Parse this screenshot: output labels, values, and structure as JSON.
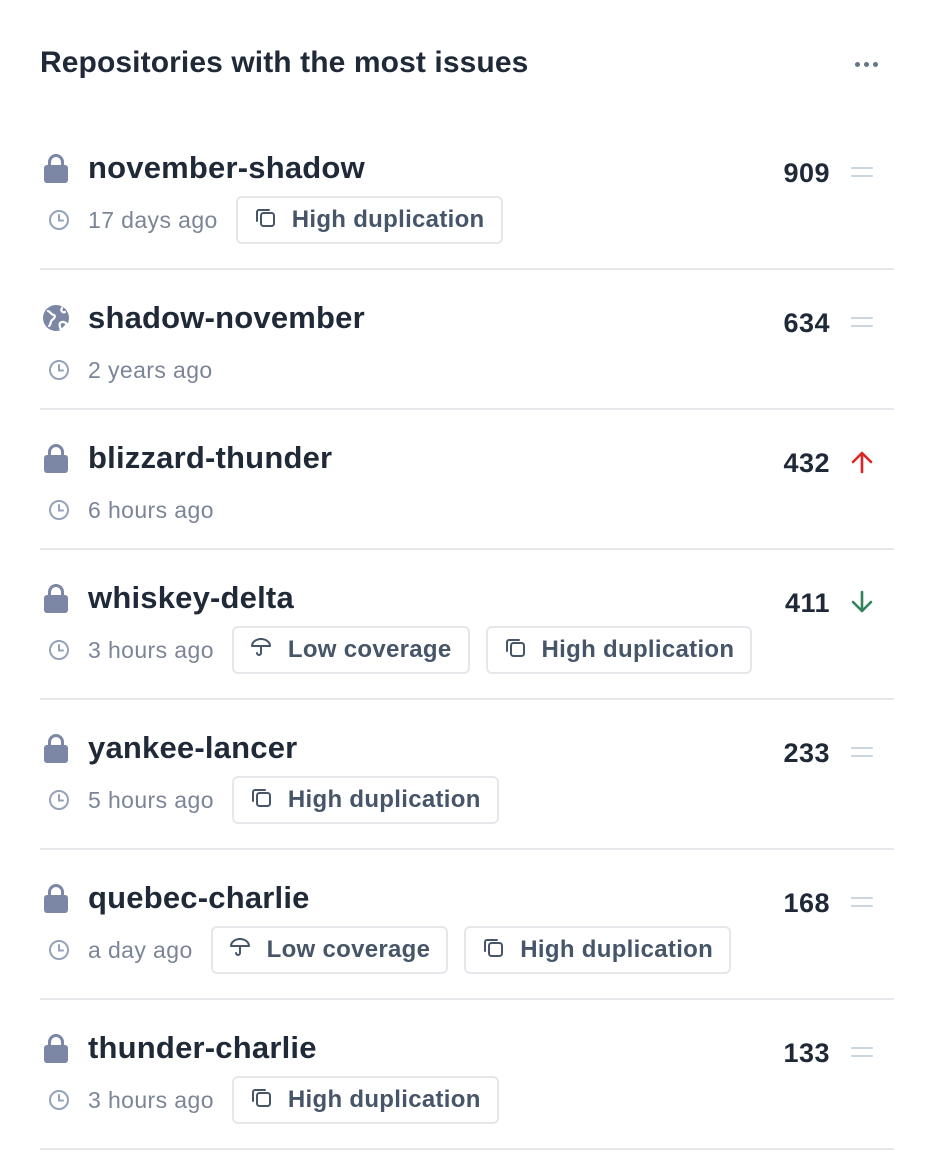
{
  "header": {
    "title": "Repositories with the most issues"
  },
  "rows": [
    {
      "name": "november-shadow",
      "visibility": "lock-icon",
      "time": "17 days ago",
      "badges": [
        "High duplication"
      ],
      "count": "909",
      "trend": "equals-icon"
    },
    {
      "name": "shadow-november",
      "visibility": "globe-icon",
      "time": "2 years ago",
      "badges": [],
      "count": "634",
      "trend": "equals-icon"
    },
    {
      "name": "blizzard-thunder",
      "visibility": "lock-icon",
      "time": "6 hours ago",
      "badges": [],
      "count": "432",
      "trend": "arrow-up-icon"
    },
    {
      "name": "whiskey-delta",
      "visibility": "lock-icon",
      "time": "3 hours ago",
      "badges": [
        "Low coverage",
        "High duplication"
      ],
      "count": "411",
      "trend": "arrow-down-icon"
    },
    {
      "name": "yankee-lancer",
      "visibility": "lock-icon",
      "time": "5 hours ago",
      "badges": [
        "High duplication"
      ],
      "count": "233",
      "trend": "equals-icon"
    },
    {
      "name": "quebec-charlie",
      "visibility": "lock-icon",
      "time": "a day ago",
      "badges": [
        "Low coverage",
        "High duplication"
      ],
      "count": "168",
      "trend": "equals-icon"
    },
    {
      "name": "thunder-charlie",
      "visibility": "lock-icon",
      "time": "3 hours ago",
      "badges": [
        "High duplication"
      ],
      "count": "133",
      "trend": "equals-icon"
    }
  ],
  "colors": {
    "trend_up": "#dc2626",
    "trend_down": "#2f855a",
    "trend_neutral": "#cbd5e1",
    "icon": "#7c87a5"
  }
}
